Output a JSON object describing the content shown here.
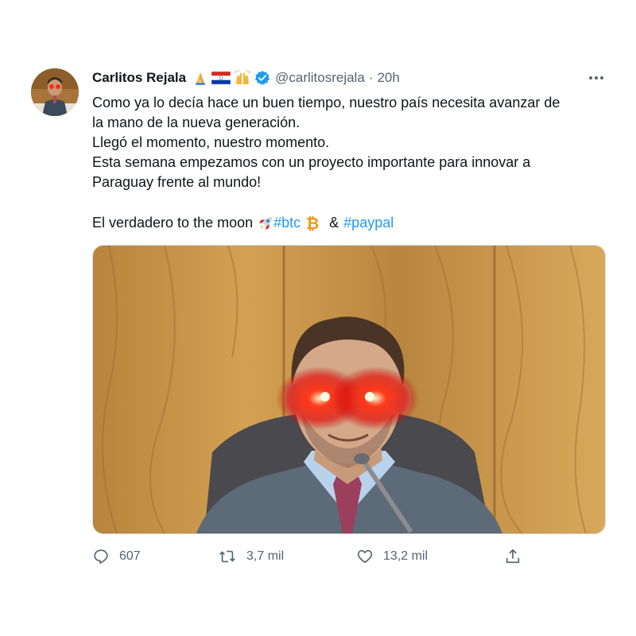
{
  "tweet": {
    "author_name": "Carlitos Rejala",
    "author_emojis": [
      "folded-hands-emoji",
      "paraguay-flag-emoji",
      "raised-hands-emoji"
    ],
    "verified": true,
    "handle": "@carlitosrejala",
    "separator": "·",
    "time": "20h",
    "text_lines": [
      "Como ya lo decía hace un buen tiempo, nuestro país necesita avanzar de",
      "la mano de la nueva generación.",
      "Llegó el momento, nuestro momento.",
      "Esta semana empezamos con un proyecto importante para innovar a",
      "Paraguay frente al mundo!"
    ],
    "last_line_prefix": "El verdadero to the moon",
    "hashtag1": "#btc",
    "ampersand": "&",
    "hashtag2": "#paypal",
    "counts": {
      "replies": "607",
      "retweets": "3,7 mil",
      "likes": "13,2 mil"
    }
  },
  "colors": {
    "text": "#0f1419",
    "secondary": "#536471",
    "link": "#1d9bf0",
    "verified": "#1d9bf0"
  },
  "icons": [
    "more-icon",
    "verified-icon",
    "rocket-emoji",
    "bitcoin-emoji",
    "reply-icon",
    "retweet-icon",
    "like-icon",
    "share-icon"
  ]
}
